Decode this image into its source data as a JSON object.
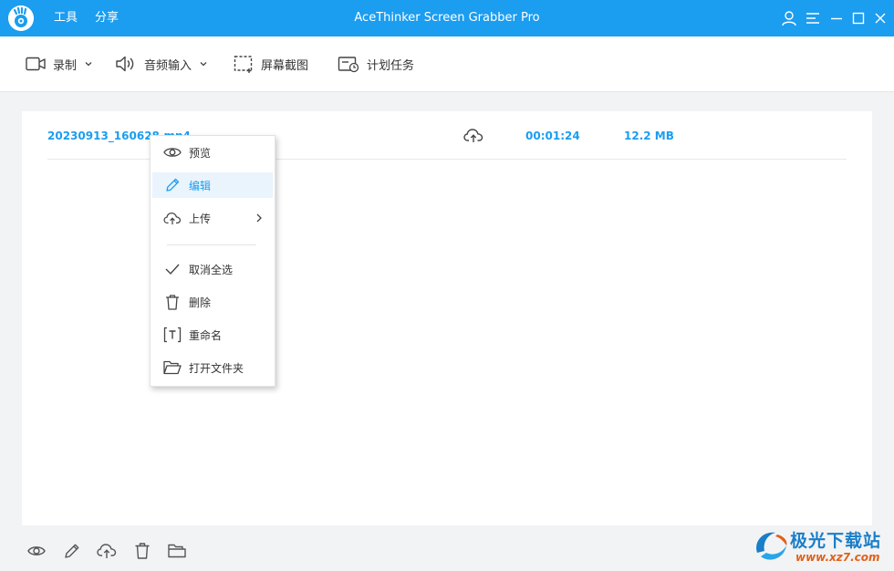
{
  "titlebar": {
    "menu": [
      "工具",
      "分享"
    ],
    "title": "AceThinker Screen Grabber Pro"
  },
  "toolbar": {
    "record_label": "录制",
    "audio_label": "音频输入",
    "screenshot_label": "屏幕截图",
    "schedule_label": "计划任务"
  },
  "file_list": {
    "rows": [
      {
        "name": "20230913_160628.mp4",
        "duration": "00:01:24",
        "size": "12.2 MB"
      }
    ]
  },
  "context_menu": {
    "items": [
      "预览",
      "编辑",
      "上传",
      "取消全选",
      "删除",
      "重命名",
      "打开文件夹"
    ],
    "hovered": "编辑"
  },
  "watermark": {
    "name": "极光下载站",
    "url": "www.xz7.com"
  },
  "colors": {
    "accent": "#1b9df0",
    "background": "#f2f3f5"
  }
}
